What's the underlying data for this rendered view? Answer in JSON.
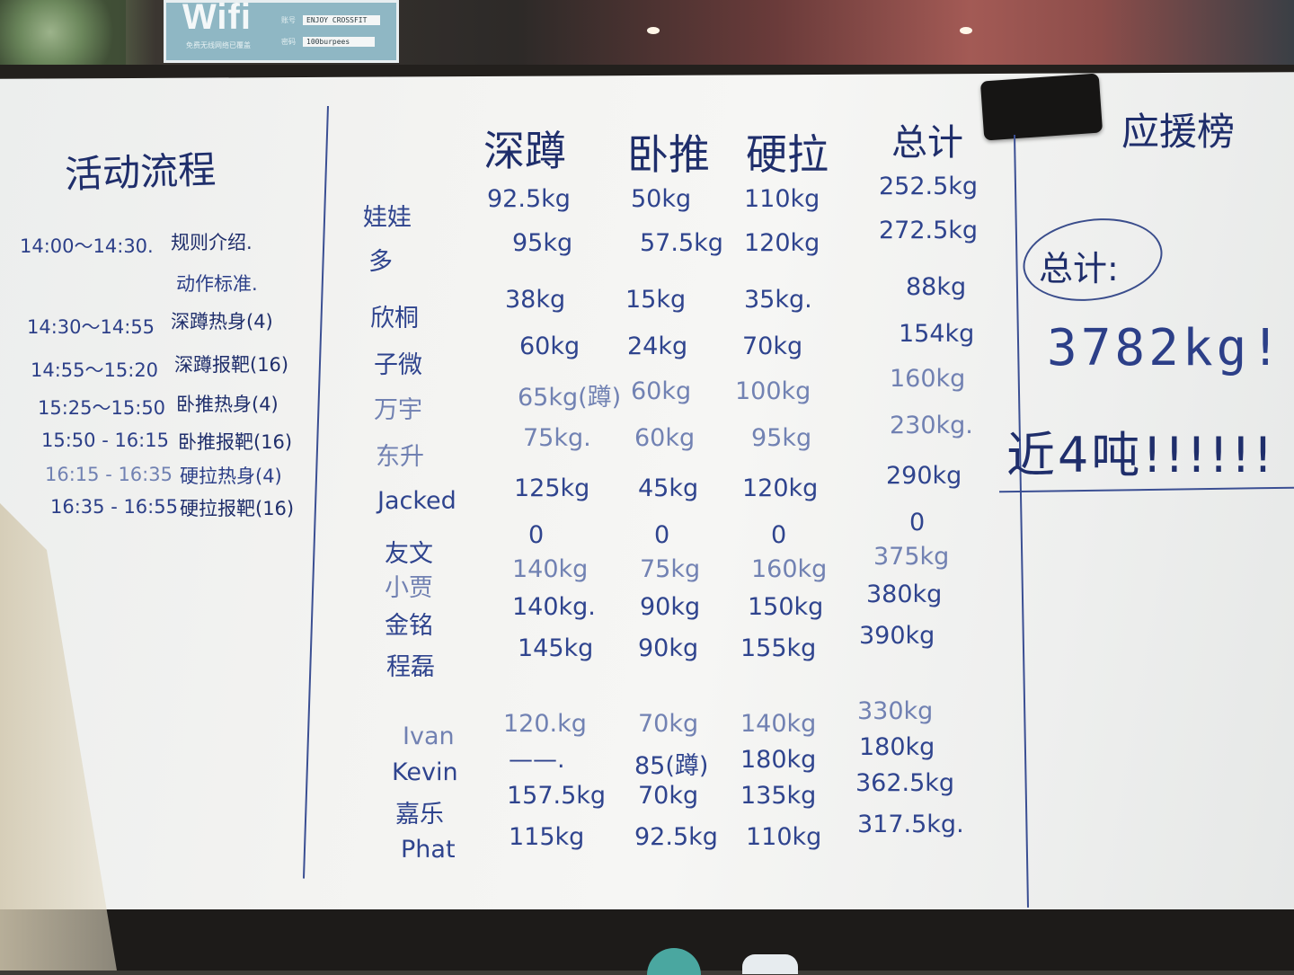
{
  "wifi": {
    "title": "Wifi",
    "subtitle": "免费无线网络已覆盖",
    "label_ssid": "账号",
    "label_password": "密码",
    "ssid": "ENJOY CROSSFIT",
    "password": "100burpees"
  },
  "schedule": {
    "title": "活动流程",
    "rows": [
      {
        "time": "14:00～14:30.",
        "event": "规则介绍."
      },
      {
        "time": "",
        "event": "动作标准."
      },
      {
        "time": "14:30～14:55",
        "event": "深蹲热身(4)"
      },
      {
        "time": "14:55～15:20",
        "event": "深蹲报靶(16)"
      },
      {
        "time": "15:25～15:50",
        "event": "卧推热身(4)"
      },
      {
        "time": "15:50 - 16:15",
        "event": "卧推报靶(16)"
      },
      {
        "time": "16:15 - 16:35",
        "event": "硬拉热身(4)"
      },
      {
        "time": "16:35 - 16:55",
        "event": "硬拉报靶(16)"
      }
    ]
  },
  "table": {
    "headers": [
      "深蹲",
      "卧推",
      "硬拉",
      "总计"
    ],
    "rows": [
      {
        "name": "娃娃",
        "squat": "92.5kg",
        "bench": "50kg",
        "deadlift": "110kg",
        "total": "252.5kg"
      },
      {
        "name": "多",
        "squat": "95kg",
        "bench": "57.5kg",
        "deadlift": "120kg",
        "total": "272.5kg"
      },
      {
        "name": "欣桐",
        "squat": "38kg",
        "bench": "15kg",
        "deadlift": "35kg.",
        "total": "88kg"
      },
      {
        "name": "子微",
        "squat": "60kg",
        "bench": "24kg",
        "deadlift": "70kg",
        "total": "154kg"
      },
      {
        "name": "万宇",
        "squat": "65kg(蹲)",
        "bench": "60kg",
        "deadlift": "100kg",
        "total": "160kg"
      },
      {
        "name": "东升",
        "squat": "75kg.",
        "bench": "60kg",
        "deadlift": "95kg",
        "total": "230kg."
      },
      {
        "name": "Jacked",
        "squat": "125kg",
        "bench": "45kg",
        "deadlift": "120kg",
        "total": "290kg"
      },
      {
        "name": "友文",
        "squat": "0",
        "bench": "0",
        "deadlift": "0",
        "total": "0"
      },
      {
        "name": "小贾",
        "squat": "140kg",
        "bench": "75kg",
        "deadlift": "160kg",
        "total": "375kg"
      },
      {
        "name": "金铭",
        "squat": "140kg.",
        "bench": "90kg",
        "deadlift": "150kg",
        "total": "380kg"
      },
      {
        "name": "程磊",
        "squat": "145kg",
        "bench": "90kg",
        "deadlift": "155kg",
        "total": "390kg"
      },
      {
        "name": "Ivan",
        "squat": "120.kg",
        "bench": "70kg",
        "deadlift": "140kg",
        "total": "330kg"
      },
      {
        "name": "Kevin",
        "squat": "——.",
        "bench": "85(蹲)",
        "deadlift": "180kg",
        "total": "180kg"
      },
      {
        "name": "嘉乐",
        "squat": "157.5kg",
        "bench": "70kg",
        "deadlift": "135kg",
        "total": "362.5kg"
      },
      {
        "name": "Phat",
        "squat": "115kg",
        "bench": "92.5kg",
        "deadlift": "110kg",
        "total": "317.5kg."
      }
    ]
  },
  "cheer": {
    "title": "应援榜",
    "total_label": "总计:",
    "total_value": "3782kg!!!",
    "tons": "近4吨!!!!!!"
  }
}
